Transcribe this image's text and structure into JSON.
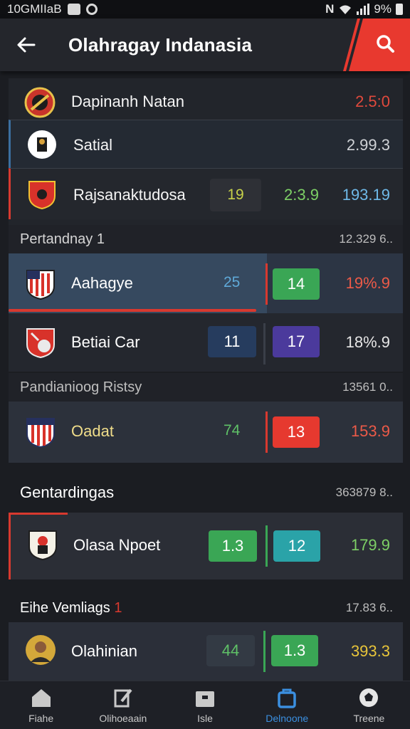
{
  "status_bar": {
    "left_text": "10GMIIaB",
    "battery": "9%"
  },
  "app_bar": {
    "title": "Olahragay Indanasia"
  },
  "top_list": [
    {
      "name": "Dapinanh Natan",
      "value": "2.5:0",
      "value_color": "#e0493c"
    },
    {
      "name": "Satial",
      "value": "2.99.3",
      "value_color": "#d0d0d0"
    },
    {
      "name": "Rajsanaktudosa",
      "score_a": "19",
      "score_b": "2:3.9",
      "value": "193.19",
      "value_color": "#6fb9e8"
    }
  ],
  "section_1": {
    "label": "Pertandnay 1",
    "count": "12.329 6..",
    "rows": [
      {
        "name": "Aahagye",
        "score_a": "25",
        "score_b": "14",
        "value": "19%.9"
      },
      {
        "name": "Betiai Car",
        "score_a": "11",
        "score_b": "17",
        "value": "18%.9"
      }
    ]
  },
  "section_2": {
    "label": "Pandianioog Ristsy",
    "count": "13561 0..",
    "rows": [
      {
        "name": "Oadat",
        "score_a": "74",
        "score_b": "13",
        "value": "153.9"
      }
    ]
  },
  "section_3": {
    "label": "Gentardingas",
    "count": "363879 8..",
    "rows": [
      {
        "name": "Olasa Npoet",
        "score_a": "1.3",
        "score_b": "12",
        "value": "179.9"
      }
    ]
  },
  "section_4": {
    "label": "Eihe Vemliags",
    "label_suffix": "1",
    "count": "17.83 6..",
    "rows": [
      {
        "name": "Olahinian",
        "score_a": "44",
        "score_b": "1.3",
        "value": "393.3"
      }
    ]
  },
  "bottom_nav": [
    {
      "label": "Fiahe",
      "icon": "home-icon"
    },
    {
      "label": "Olihoeaain",
      "icon": "edit-icon"
    },
    {
      "label": "Isle",
      "icon": "briefcase-icon"
    },
    {
      "label": "Delnoone",
      "icon": "bag-icon",
      "active": true
    },
    {
      "label": "Treene",
      "icon": "ball-icon"
    }
  ]
}
